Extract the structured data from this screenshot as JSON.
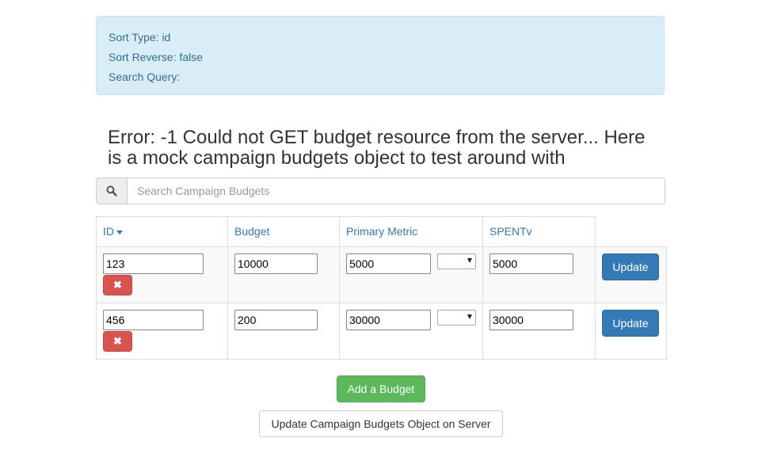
{
  "info": {
    "sort_type": "Sort Type: id",
    "sort_reverse": "Sort Reverse: false",
    "search_query": "Search Query:"
  },
  "error_heading": "Error: -1 Could not GET budget resource from the server... Here is a mock campaign budgets object to test around with",
  "search": {
    "icon": "search-icon",
    "placeholder": "Search Campaign Budgets",
    "value": ""
  },
  "table": {
    "headers": {
      "id": "ID",
      "budget": "Budget",
      "primary_metric": "Primary Metric",
      "spent": "SPENTv"
    },
    "rows": [
      {
        "id": "123",
        "budget": "10000",
        "primary_metric": "5000",
        "metric_select": "",
        "spent": "5000",
        "update_label": "Update",
        "delete_icon": "close-icon"
      },
      {
        "id": "456",
        "budget": "200",
        "primary_metric": "30000",
        "metric_select": "",
        "spent": "30000",
        "update_label": "Update",
        "delete_icon": "close-icon"
      }
    ]
  },
  "buttons": {
    "add_budget": "Add a Budget",
    "update_server": "Update Campaign Budgets Object on Server"
  },
  "colors": {
    "info_bg": "#d9edf7",
    "link": "#337ab7",
    "danger": "#d9534f",
    "primary": "#337ab7",
    "success": "#5cb85c"
  }
}
